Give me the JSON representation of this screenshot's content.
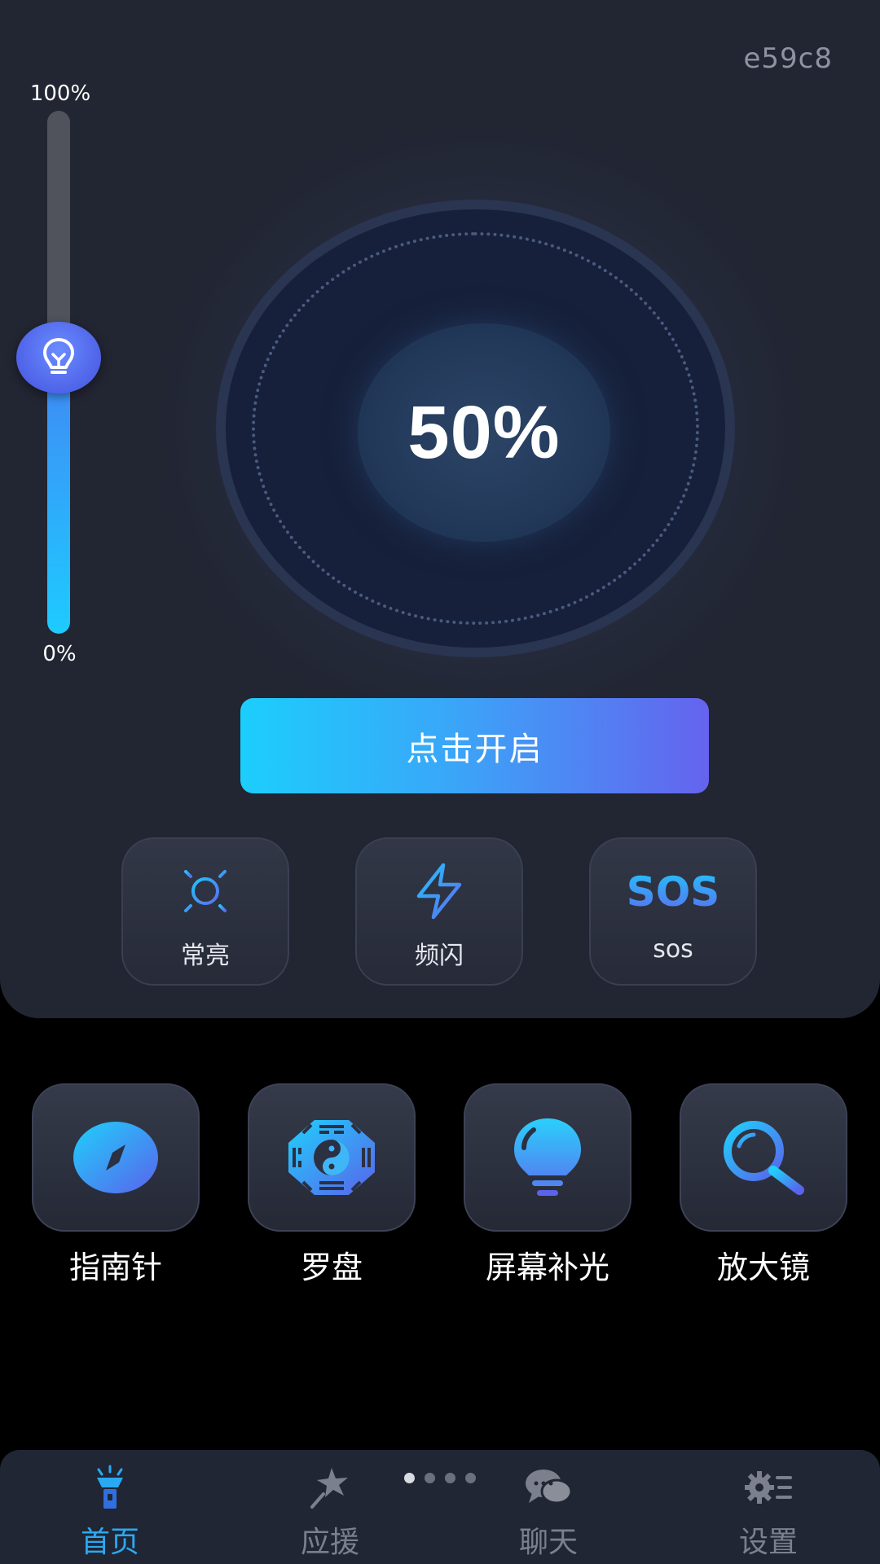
{
  "header": {
    "device_id": "e59c8"
  },
  "brightness_slider": {
    "max_label": "100%",
    "min_label": "0%",
    "level_percent": 50
  },
  "dial": {
    "value": "50%"
  },
  "start_button": {
    "label": "点击开启"
  },
  "modes": [
    {
      "label": "常亮",
      "icon": "sun-icon"
    },
    {
      "label": "频闪",
      "icon": "lightning-icon"
    },
    {
      "label": "sos",
      "icon": "sos-icon",
      "icon_text": "SOS"
    }
  ],
  "tools": [
    {
      "label": "指南针",
      "icon": "compass-icon"
    },
    {
      "label": "罗盘",
      "icon": "bagua-icon"
    },
    {
      "label": "屏幕补光",
      "icon": "bulb-icon"
    },
    {
      "label": "放大镜",
      "icon": "magnifier-icon"
    }
  ],
  "page_indicator": {
    "count": 4,
    "active_index": 0
  },
  "bottom_nav": [
    {
      "label": "首页",
      "icon": "flashlight-icon",
      "active": true
    },
    {
      "label": "应援",
      "icon": "star-wand-icon",
      "active": false
    },
    {
      "label": "聊天",
      "icon": "chat-icon",
      "active": false
    },
    {
      "label": "设置",
      "icon": "settings-icon",
      "active": false
    }
  ],
  "colors": {
    "accent": "#2aa9f3",
    "gradient_start": "#1ccefc",
    "gradient_end": "#6563ee",
    "card_bg": "#222532"
  }
}
